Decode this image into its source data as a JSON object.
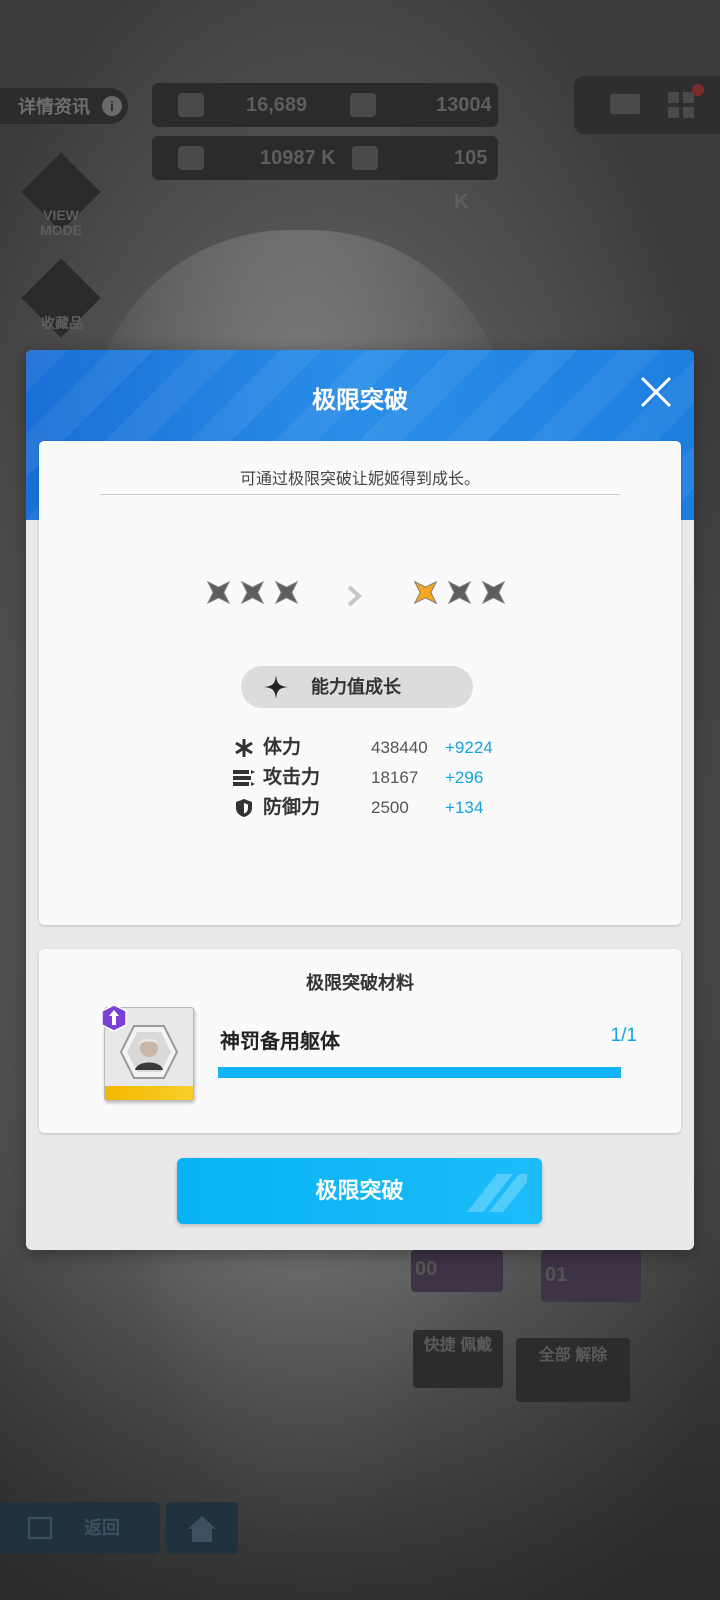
{
  "background": {
    "details_label": "详情资讯",
    "resources": [
      {
        "icon": "crystal-icon",
        "value": "16,689"
      },
      {
        "icon": "credit-card-icon",
        "value": "13004 K"
      },
      {
        "icon": "battle-data-icon",
        "value": "10987 K"
      },
      {
        "icon": "core-dust-icon",
        "value": "105 K"
      }
    ],
    "view_mode_label": "VIEW MODE",
    "collection_label": "收藏品",
    "slots": [
      "00",
      "01"
    ],
    "quick_equip_label": "快捷 佩戴",
    "unequip_all_label": "全部 解除",
    "back_label": "返回"
  },
  "modal": {
    "title": "极限突破",
    "description": "可通过极限突破让妮姬得到成长。",
    "stars_before": {
      "filled": 0,
      "total": 3
    },
    "stars_after": {
      "filled": 1,
      "total": 3
    },
    "growth_label": "能力值成长",
    "stats": [
      {
        "icon": "hp-icon",
        "name": "体力",
        "value": "438440",
        "increase": "+9224"
      },
      {
        "icon": "attack-icon",
        "name": "攻击力",
        "value": "18167",
        "increase": "+296"
      },
      {
        "icon": "defense-icon",
        "name": "防御力",
        "value": "2500",
        "increase": "+134"
      }
    ],
    "material_title": "极限突破材料",
    "material": {
      "name": "神罚备用躯体",
      "count": "1/1",
      "progress": 1.0
    },
    "confirm_label": "极限突破"
  },
  "colors": {
    "accent": "#12a3e0",
    "star_active": "#f5a623",
    "header": "#1a6fd6"
  }
}
